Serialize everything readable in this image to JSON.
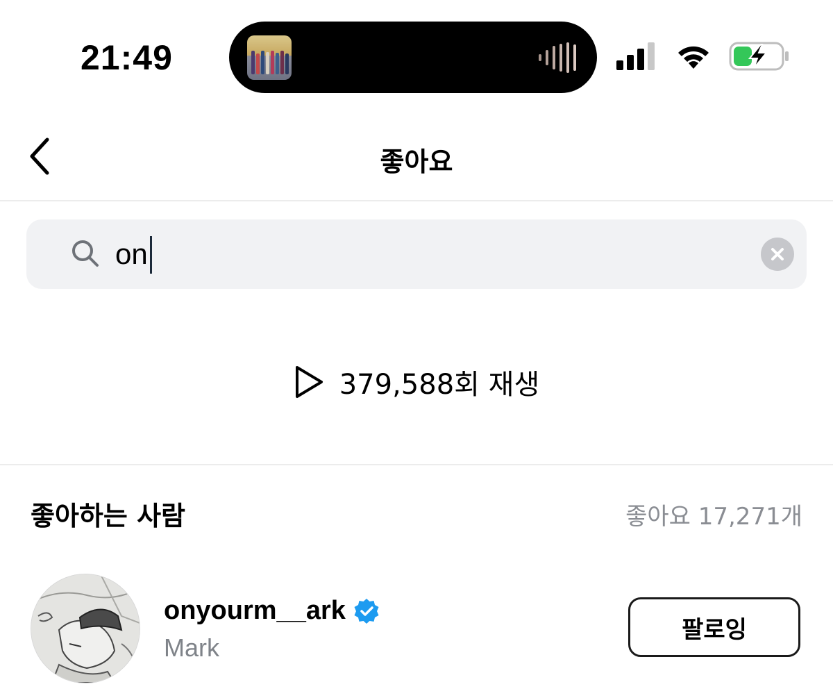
{
  "status_bar": {
    "time": "21:49",
    "signal_icon": "cellular-signal-icon",
    "wifi_icon": "wifi-icon",
    "battery_icon": "battery-charging-icon",
    "battery_color": "#34c759"
  },
  "header": {
    "title": "좋아요",
    "back_icon": "chevron-left-icon"
  },
  "search": {
    "value": "on",
    "search_icon": "search-icon",
    "clear_icon": "clear-icon"
  },
  "plays": {
    "icon": "play-icon",
    "text": "379,588회 재생"
  },
  "likers": {
    "section_title": "좋아하는 사람",
    "likes_count": "좋아요 17,271개",
    "users": [
      {
        "username": "onyourm__ark",
        "verified": true,
        "display_name": "Mark",
        "button_label": "팔로잉"
      }
    ]
  },
  "colors": {
    "verified_badge": "#1d9bf0",
    "muted_text": "#8a8d93",
    "search_bg": "#f1f2f4"
  }
}
